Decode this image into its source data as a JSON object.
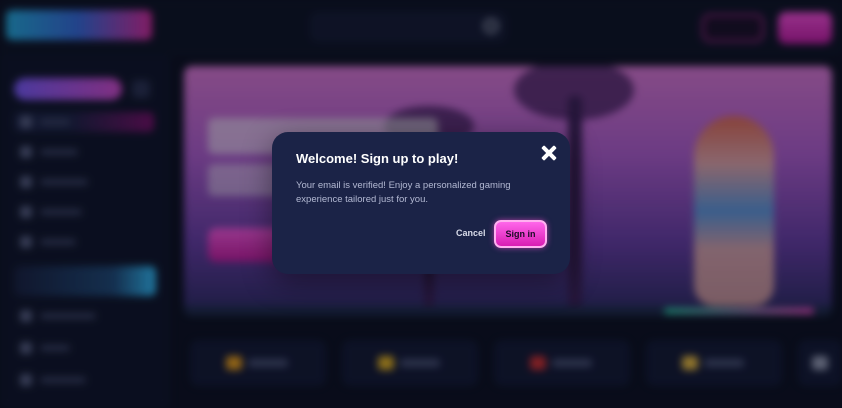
{
  "modal": {
    "title": "Welcome! Sign up to play!",
    "message": "Your email is verified! Enjoy a personalized gaming experience tailored just for you.",
    "cancel_label": "Cancel",
    "signin_label": "Sign in",
    "close_icon": "close-icon"
  },
  "colors": {
    "modal_bg": "#1b2347",
    "accent": "#e233c4",
    "page_bg": "#0b0f1f"
  },
  "background": {
    "header_icons": [
      "logo",
      "search-icon"
    ],
    "hero_progress": 0.25
  }
}
